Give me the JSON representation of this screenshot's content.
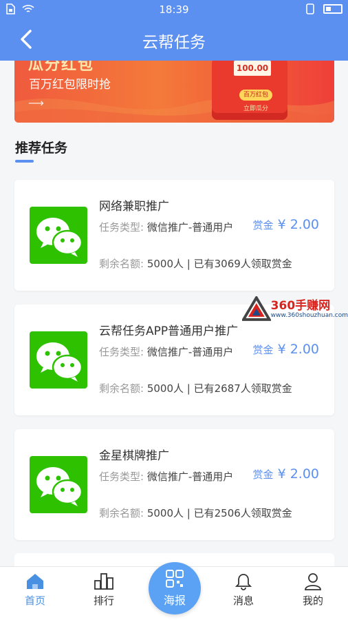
{
  "status_bar": {
    "time": "18:39"
  },
  "nav": {
    "title": "云帮任务"
  },
  "banner": {
    "title": "瓜分红包",
    "subtitle": "百万红包限时抢",
    "envelope_amount": "100.00",
    "envelope_label": "百万红包",
    "envelope_action": "立即瓜分"
  },
  "section": {
    "title": "推荐任务"
  },
  "tasks": [
    {
      "name": "网络兼职推广",
      "type_label": "任务类型:",
      "type_value": "微信推广-普通用户",
      "reward_label": "赏金",
      "reward_amount": "¥ 2.00",
      "quota_label": "剩余名额:",
      "quota_value": "5000人 | 已有3069人领取赏金"
    },
    {
      "name": "云帮任务APP普通用户推广",
      "type_label": "任务类型:",
      "type_value": "微信推广-普通用户",
      "reward_label": "赏金",
      "reward_amount": "¥ 2.00",
      "quota_label": "剩余名额:",
      "quota_value": "5000人 | 已有2687人领取赏金"
    },
    {
      "name": "金星棋牌推广",
      "type_label": "任务类型:",
      "type_value": "微信推广-普通用户",
      "reward_label": "赏金",
      "reward_amount": "¥ 2.00",
      "quota_label": "剩余名额:",
      "quota_value": "5000人 | 已有2506人领取赏金"
    }
  ],
  "watermark": {
    "text": "360手赚网",
    "url": "www.360shouzhuan.com"
  },
  "tabbar": {
    "home": "首页",
    "rank": "排行",
    "poster": "海报",
    "messages": "消息",
    "mine": "我的"
  },
  "colors": {
    "primary": "#5b8ff0",
    "wechat": "#2dc100",
    "banner": "#f05a3e"
  }
}
